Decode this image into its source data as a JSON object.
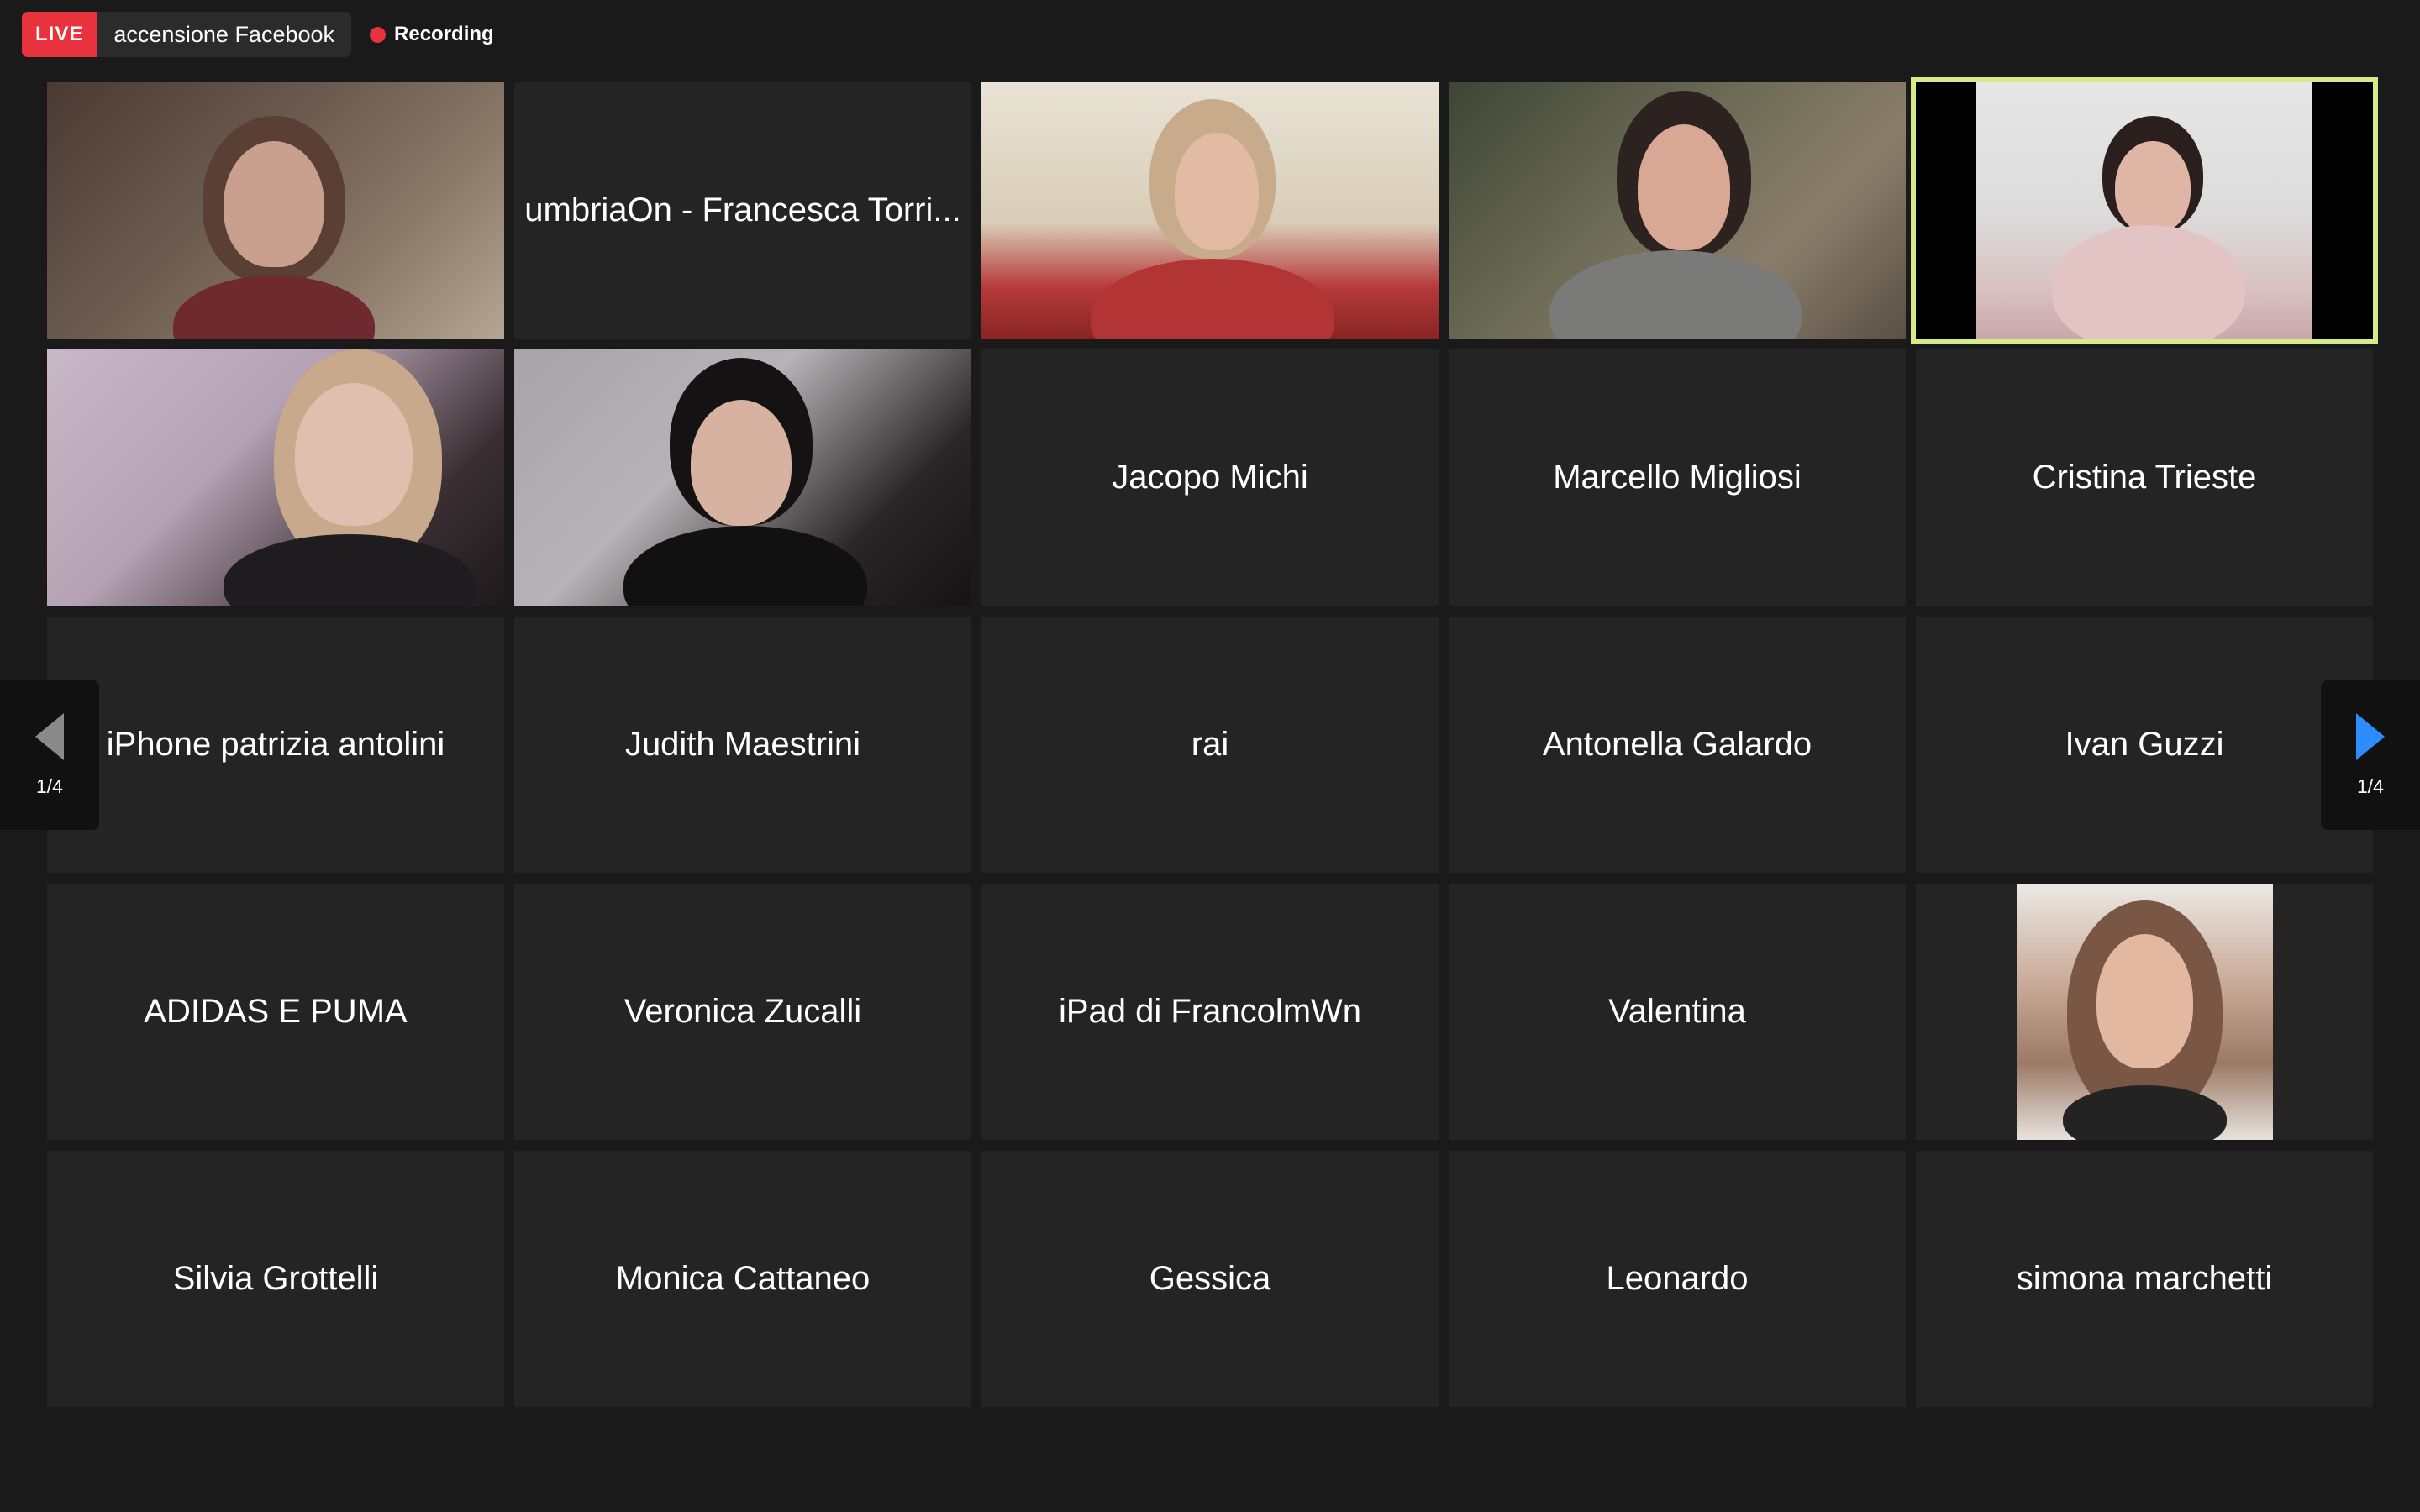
{
  "topbar": {
    "live_badge": "LIVE",
    "live_label": "accensione Facebook",
    "recording_label": "Recording"
  },
  "pagination": {
    "left_count": "1/4",
    "right_count": "1/4"
  },
  "participants": [
    {
      "name": "",
      "video": true
    },
    {
      "name": "umbriaOn - Francesca Torri...",
      "video": false
    },
    {
      "name": "",
      "video": true
    },
    {
      "name": "",
      "video": true
    },
    {
      "name": "",
      "video": true,
      "active_speaker": true
    },
    {
      "name": "",
      "video": true
    },
    {
      "name": "",
      "video": true
    },
    {
      "name": "Jacopo Michi",
      "video": false
    },
    {
      "name": "Marcello Migliosi",
      "video": false
    },
    {
      "name": "Cristina Trieste",
      "video": false
    },
    {
      "name": "iPhone patrizia antolini",
      "video": false
    },
    {
      "name": "Judith Maestrini",
      "video": false
    },
    {
      "name": "rai",
      "video": false
    },
    {
      "name": "Antonella Galardo",
      "video": false
    },
    {
      "name": "Ivan Guzzi",
      "video": false
    },
    {
      "name": "ADIDAS E PUMA",
      "video": false
    },
    {
      "name": "Veronica Zucalli",
      "video": false
    },
    {
      "name": "iPad di FrancolmWn",
      "video": false
    },
    {
      "name": "Valentina",
      "video": false
    },
    {
      "name": "",
      "video": true,
      "profile_photo": true
    },
    {
      "name": "Silvia Grottelli",
      "video": false
    },
    {
      "name": "Monica Cattaneo",
      "video": false
    },
    {
      "name": "Gessica",
      "video": false
    },
    {
      "name": "Leonardo",
      "video": false
    },
    {
      "name": "simona marchetti",
      "video": false
    }
  ],
  "colors": {
    "background": "#1a1a1a",
    "tile": "#242424",
    "live_red": "#e8323d",
    "active_speaker_border": "#d7ea8a",
    "arrow_blue": "#2d8cff"
  }
}
